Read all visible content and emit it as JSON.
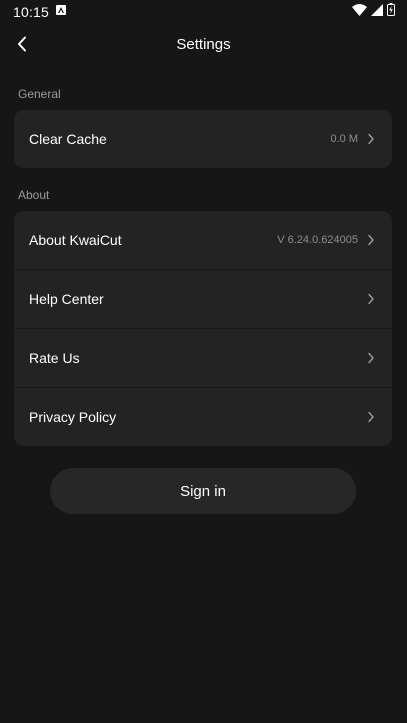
{
  "status_bar": {
    "time": "10:15",
    "icons": [
      "app-notification-icon",
      "wifi-icon",
      "signal-icon",
      "battery-icon"
    ]
  },
  "header": {
    "title": "Settings",
    "back_icon": "chevron-left-icon"
  },
  "sections": {
    "general": {
      "label": "General",
      "items": [
        {
          "label": "Clear Cache",
          "value": "0.0 M"
        }
      ]
    },
    "about": {
      "label": "About",
      "items": [
        {
          "label": "About KwaiCut",
          "value": "V 6.24.0.624005"
        },
        {
          "label": "Help Center",
          "value": ""
        },
        {
          "label": "Rate Us",
          "value": ""
        },
        {
          "label": "Privacy Policy",
          "value": ""
        }
      ]
    }
  },
  "sign_in": {
    "label": "Sign in"
  },
  "colors": {
    "background": "#161616",
    "card": "#232323",
    "button": "#272727",
    "text": "#ffffff",
    "secondary_text": "#9b9b9b"
  }
}
